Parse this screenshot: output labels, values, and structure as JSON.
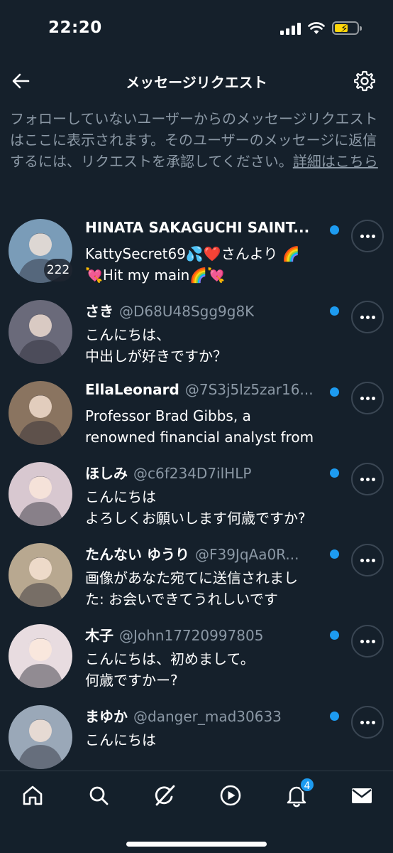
{
  "status": {
    "time": "22:20"
  },
  "header": {
    "title": "メッセージリクエスト",
    "back_icon": "arrow-left-icon",
    "settings_icon": "gear-icon"
  },
  "intro": {
    "text": "フォローしていないユーザーからのメッセージリクエストはここに表示されます。そのユーザーのメッセージに返信するには、リクエストを承認してください。",
    "link": "詳細はこちら"
  },
  "requests": [
    {
      "name": "HINATA SAKAGUCHI SAINT...",
      "handle": "",
      "line1": "KattySecret69💦❤️さんより 🌈",
      "line2": "💘Hit my main🌈💘",
      "badge": "222",
      "avatar_color": "#7a9cb8"
    },
    {
      "name": "さき",
      "handle": "@D68U48Sgg9g8K",
      "line1": "こんにちは、",
      "line2": "中出しが好きですか？",
      "badge": "",
      "avatar_color": "#6a6a7a"
    },
    {
      "name": "EllaLeonard",
      "handle": "@7S3j5lz5zar16...",
      "line1": "Professor Brad Gibbs, a",
      "line2": "renowned financial analyst from",
      "badge": "",
      "avatar_color": "#8a7460"
    },
    {
      "name": "ほしみ",
      "handle": "@c6f234D7ilHLP",
      "line1": "こんにちは",
      "line2": "よろしくお願いします何歳ですか?",
      "badge": "",
      "avatar_color": "#d8c8d0"
    },
    {
      "name": "たんない ゆうり",
      "handle": "@F39JqAa0R...",
      "line1": "画像があなた宛てに送信されまし",
      "line2": "た: お会いできてうれしいです",
      "badge": "",
      "avatar_color": "#b8a890"
    },
    {
      "name": "木子",
      "handle": "@John17720997805",
      "line1": "こんにちは、初めまして。",
      "line2": "何歳ですかー?",
      "badge": "",
      "avatar_color": "#e8dce0"
    },
    {
      "name": "まゆか",
      "handle": "@danger_mad30633",
      "line1": "こんにちは",
      "line2": "",
      "badge": "",
      "avatar_color": "#9aa8b8"
    }
  ],
  "nav": {
    "items": [
      {
        "icon": "home-icon"
      },
      {
        "icon": "search-icon"
      },
      {
        "icon": "grok-icon"
      },
      {
        "icon": "play-icon"
      },
      {
        "icon": "bell-icon",
        "badge": "4"
      },
      {
        "icon": "mail-icon"
      }
    ]
  },
  "colors": {
    "background": "#15202b",
    "accent": "#1d9bf0",
    "muted": "#8b98a5"
  }
}
